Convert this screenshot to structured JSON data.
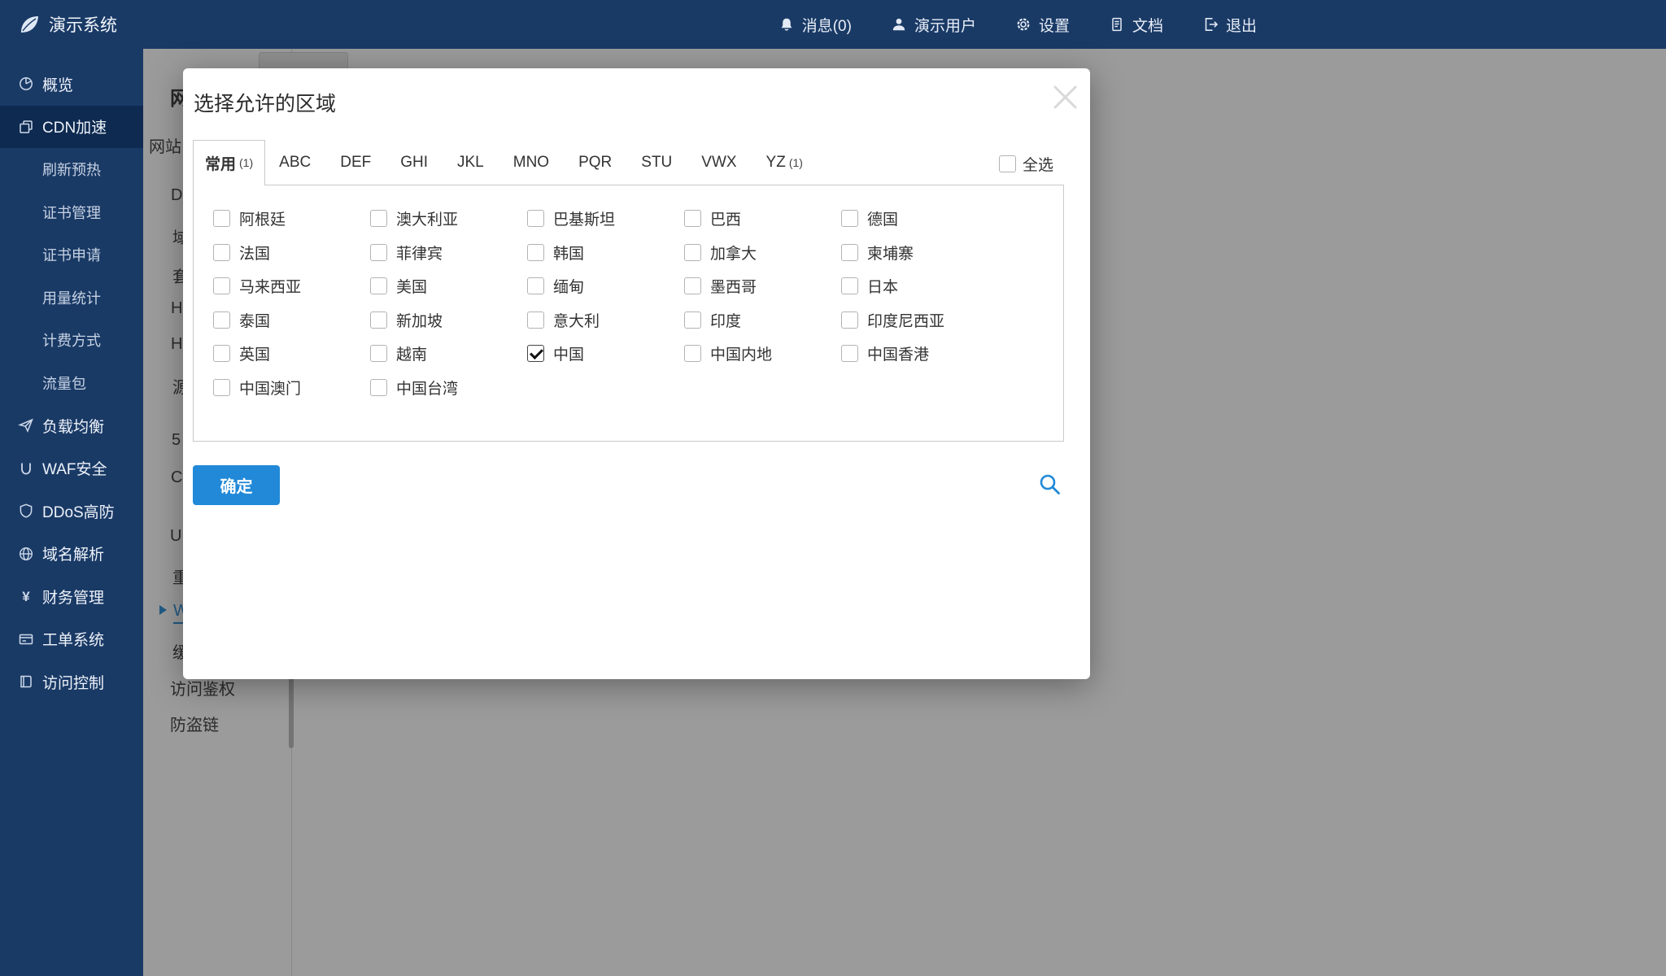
{
  "colors": {
    "navy": "#1a3a66",
    "accent": "#2189d8"
  },
  "topbar": {
    "brand": "演示系统",
    "items": [
      {
        "label": "消息(0)"
      },
      {
        "label": "演示用户"
      },
      {
        "label": "设置"
      },
      {
        "label": "文档"
      },
      {
        "label": "退出"
      }
    ]
  },
  "sidebar": {
    "items": [
      {
        "label": "概览"
      },
      {
        "label": "CDN加速",
        "active": true
      },
      {
        "label": "刷新预热",
        "sub": true
      },
      {
        "label": "证书管理",
        "sub": true
      },
      {
        "label": "证书申请",
        "sub": true
      },
      {
        "label": "用量统计",
        "sub": true
      },
      {
        "label": "计费方式",
        "sub": true
      },
      {
        "label": "流量包",
        "sub": true
      },
      {
        "label": "负载均衡"
      },
      {
        "label": "WAF安全"
      },
      {
        "label": "DDoS高防"
      },
      {
        "label": "域名解析"
      },
      {
        "label": "财务管理"
      },
      {
        "label": "工单系统"
      },
      {
        "label": "访问控制"
      }
    ]
  },
  "background": {
    "fragments": [
      "网",
      "网站",
      "D",
      "域",
      "套",
      "H",
      "H",
      "源",
      "5",
      "C",
      "U",
      "重",
      "W",
      "缓",
      "访问鉴权",
      "防盗链"
    ]
  },
  "modal": {
    "title": "选择允许的区域",
    "select_all_label": "全选",
    "confirm_label": "确定",
    "tabs": [
      {
        "label": "常用",
        "count": "(1)",
        "active": true
      },
      {
        "label": "ABC"
      },
      {
        "label": "DEF"
      },
      {
        "label": "GHI"
      },
      {
        "label": "JKL"
      },
      {
        "label": "MNO"
      },
      {
        "label": "PQR"
      },
      {
        "label": "STU"
      },
      {
        "label": "VWX"
      },
      {
        "label": "YZ",
        "count": "(1)"
      }
    ],
    "countries": [
      {
        "name": "阿根廷",
        "checked": false
      },
      {
        "name": "澳大利亚",
        "checked": false
      },
      {
        "name": "巴基斯坦",
        "checked": false
      },
      {
        "name": "巴西",
        "checked": false
      },
      {
        "name": "德国",
        "checked": false
      },
      {
        "name": "法国",
        "checked": false
      },
      {
        "name": "菲律宾",
        "checked": false
      },
      {
        "name": "韩国",
        "checked": false
      },
      {
        "name": "加拿大",
        "checked": false
      },
      {
        "name": "柬埔寨",
        "checked": false
      },
      {
        "name": "马来西亚",
        "checked": false
      },
      {
        "name": "美国",
        "checked": false
      },
      {
        "name": "缅甸",
        "checked": false
      },
      {
        "name": "墨西哥",
        "checked": false
      },
      {
        "name": "日本",
        "checked": false
      },
      {
        "name": "泰国",
        "checked": false
      },
      {
        "name": "新加坡",
        "checked": false
      },
      {
        "name": "意大利",
        "checked": false
      },
      {
        "name": "印度",
        "checked": false
      },
      {
        "name": "印度尼西亚",
        "checked": false
      },
      {
        "name": "英国",
        "checked": false
      },
      {
        "name": "越南",
        "checked": false
      },
      {
        "name": "中国",
        "checked": true
      },
      {
        "name": "中国内地",
        "checked": false
      },
      {
        "name": "中国香港",
        "checked": false
      },
      {
        "name": "中国澳门",
        "checked": false
      },
      {
        "name": "中国台湾",
        "checked": false
      }
    ]
  }
}
